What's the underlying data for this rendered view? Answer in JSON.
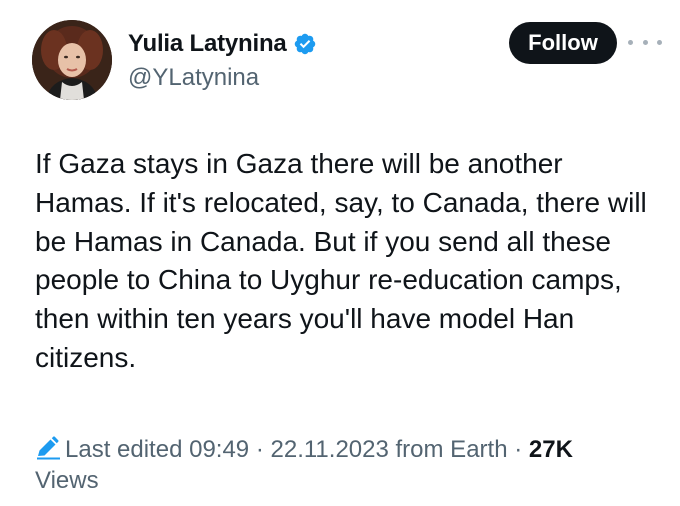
{
  "author": {
    "display_name": "Yulia Latynina",
    "handle": "@YLatynina",
    "verified": true,
    "avatar_icon": "profile-photo"
  },
  "actions": {
    "follow_label": "Follow",
    "more_icon": "more-horizontal-icon"
  },
  "tweet": {
    "text": "If Gaza stays in Gaza there will be another Hamas. If it's relocated, say, to Canada, there will be Hamas in Canada. But if you send all these people to China to Uyghur re-education camps, then within ten years you'll have model Han citizens."
  },
  "meta": {
    "edited_label": "Last edited",
    "time": "09:49",
    "separator": "·",
    "date": "22.11.2023",
    "source": "from Earth",
    "views_count": "27K",
    "views_label": "Views"
  },
  "colors": {
    "text": "#0f1419",
    "secondary": "#536471",
    "verified": "#1d9bf0",
    "button_bg": "#0f1419"
  }
}
